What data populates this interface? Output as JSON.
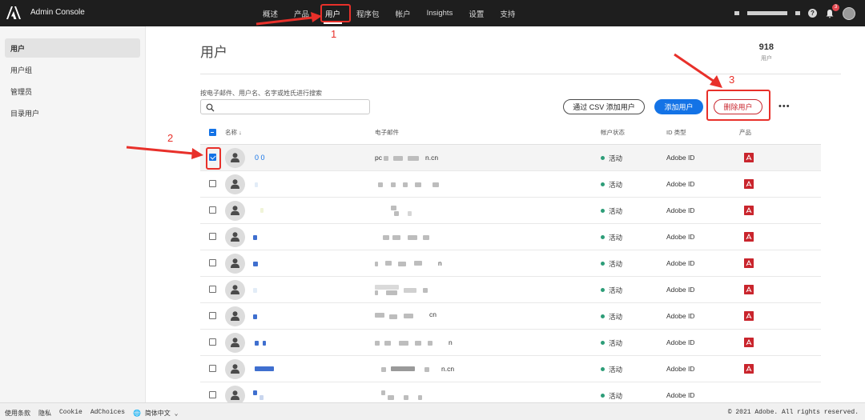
{
  "header": {
    "app_title": "Admin Console",
    "nav": [
      {
        "label": "概述"
      },
      {
        "label": "产品"
      },
      {
        "label": "用户",
        "active": true
      },
      {
        "label": "程序包"
      },
      {
        "label": "帐户"
      },
      {
        "label": "Insights"
      },
      {
        "label": "设置"
      },
      {
        "label": "支持"
      }
    ],
    "help": "?",
    "notifications_count": "3"
  },
  "sidebar": {
    "items": [
      {
        "label": "用户",
        "active": true
      },
      {
        "label": "用户组"
      },
      {
        "label": "管理员"
      },
      {
        "label": "目录用户"
      }
    ]
  },
  "main": {
    "title": "用户",
    "user_count": "918",
    "user_count_label": "用户",
    "search_label": "按电子邮件、用户名、名字或姓氏进行搜索",
    "search_placeholder": "",
    "buttons": {
      "csv": "通过 CSV 添加用户",
      "add": "添加用户",
      "delete": "删除用户",
      "more": "•••"
    },
    "columns": {
      "name": "名称",
      "email": "电子邮件",
      "status": "帐户状态",
      "id_type": "ID 类型",
      "product": "产品"
    },
    "rows": [
      {
        "name": "0 0",
        "email_prefix": "pc",
        "email_suffix": "n.cn",
        "status": "活动",
        "id_type": "Adobe ID",
        "selected": true
      },
      {
        "name": "",
        "email_prefix": "",
        "email_suffix": "",
        "status": "活动",
        "id_type": "Adobe ID"
      },
      {
        "name": "",
        "email_prefix": "",
        "email_suffix": "",
        "status": "活动",
        "id_type": "Adobe ID"
      },
      {
        "name": "",
        "email_prefix": "",
        "email_suffix": "",
        "status": "活动",
        "id_type": "Adobe ID"
      },
      {
        "name": "",
        "email_prefix": "",
        "email_suffix": "n",
        "status": "活动",
        "id_type": "Adobe ID"
      },
      {
        "name": "",
        "email_prefix": "",
        "email_suffix": "",
        "status": "活动",
        "id_type": "Adobe ID"
      },
      {
        "name": "",
        "email_prefix": "",
        "email_suffix": "cn",
        "status": "活动",
        "id_type": "Adobe ID"
      },
      {
        "name": "",
        "email_prefix": "",
        "email_suffix": "n",
        "status": "活动",
        "id_type": "Adobe ID"
      },
      {
        "name": "",
        "email_prefix": "",
        "email_suffix": "n.cn",
        "status": "活动",
        "id_type": "Adobe ID"
      },
      {
        "name": "",
        "email_prefix": "",
        "email_suffix": "",
        "status": "活动",
        "id_type": "Adobe ID"
      }
    ]
  },
  "footer": {
    "links": [
      "使用条款",
      "隐私",
      "Cookie",
      "AdChoices"
    ],
    "language": "简体中文",
    "copyright": "© 2021 Adobe. All rights reserved."
  },
  "annotations": {
    "step1": "1",
    "step2": "2",
    "step3": "3"
  },
  "colors": {
    "accent": "#1473e6",
    "danger": "#c9252d",
    "annotation": "#e8302a",
    "status_active": "#2d9d78"
  }
}
